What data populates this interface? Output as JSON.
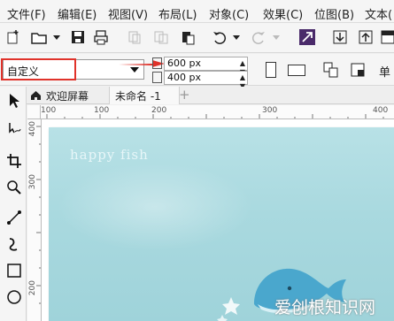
{
  "menu": {
    "file": "文件(F)",
    "edit": "编辑(E)",
    "view": "视图(V)",
    "layout": "布局(L)",
    "object": "对象(C)",
    "effects": "效果(C)",
    "bitmaps": "位图(B)",
    "text": "文本("
  },
  "property_bar": {
    "preset_value": "自定义",
    "width_value": "600 px",
    "height_value": "400 px"
  },
  "tabs": {
    "welcome": "欢迎屏幕",
    "document": "未命名 -1",
    "add": "+"
  },
  "ruler": {
    "h_labels": [
      "100",
      "100",
      "200",
      "300",
      "400"
    ],
    "v_labels": [
      "400",
      "300",
      "200"
    ]
  },
  "canvas": {
    "title": "happy fish"
  },
  "watermark": "爱创根知识网",
  "colors": {
    "accent_red": "#e0322a",
    "page_bg": "#a9d9df"
  },
  "icons": [
    "new-icon",
    "open-icon",
    "save-icon",
    "print-icon",
    "undo-icon",
    "redo-icon",
    "import-icon",
    "export-icon",
    "home-icon"
  ]
}
